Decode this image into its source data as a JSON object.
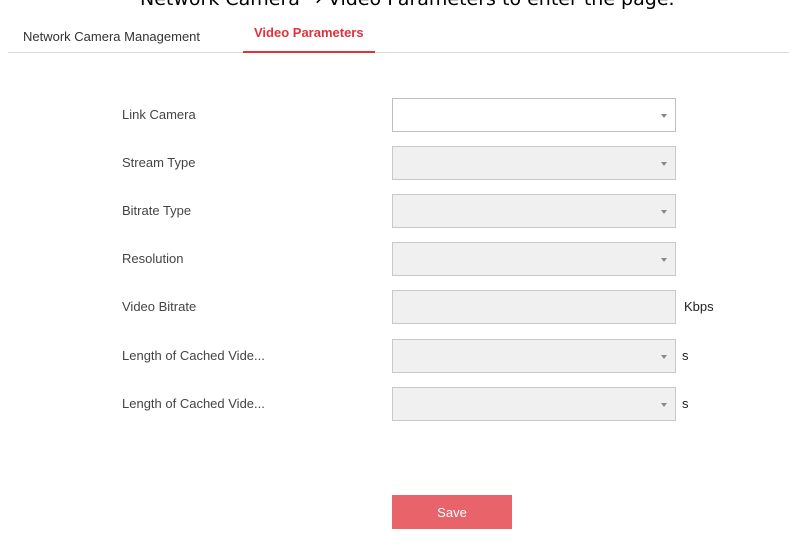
{
  "caption": "Network Camera → Video Parameters to enter the page.",
  "tabs": [
    {
      "label": "Network Camera Management",
      "active": false
    },
    {
      "label": "Video Parameters",
      "active": true
    }
  ],
  "form": {
    "fields": [
      {
        "label": "Link Camera",
        "type": "select",
        "value": "",
        "enabled": true
      },
      {
        "label": "Stream Type",
        "type": "select",
        "value": "",
        "enabled": false
      },
      {
        "label": "Bitrate Type",
        "type": "select",
        "value": "",
        "enabled": false
      },
      {
        "label": "Resolution",
        "type": "select",
        "value": "",
        "enabled": false
      },
      {
        "label": "Video Bitrate",
        "type": "input",
        "value": "",
        "unit": "Kbps",
        "enabled": false
      },
      {
        "label": "Length of Cached Vide...",
        "type": "select",
        "value": "",
        "unit": "s",
        "enabled": false
      },
      {
        "label": "Length of Cached Vide...",
        "type": "select",
        "value": "",
        "unit": "s",
        "enabled": false
      }
    ],
    "save_label": "Save"
  },
  "colors": {
    "accent": "#e0323a",
    "button": "#e8636a",
    "disabled_field": "#f0f0f0"
  },
  "icons": {
    "dropdown": "chevron-down-icon"
  }
}
